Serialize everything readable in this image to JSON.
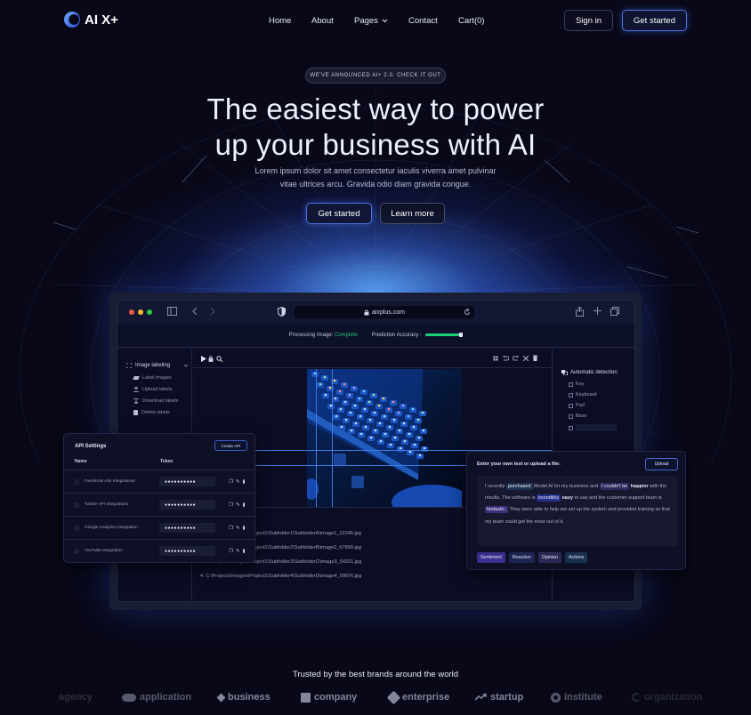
{
  "nav": {
    "logo_text": "AI X+",
    "links": [
      {
        "label": "Home"
      },
      {
        "label": "About"
      },
      {
        "label": "Pages",
        "has_dropdown": true
      },
      {
        "label": "Contact"
      },
      {
        "label": "Cart(0)"
      }
    ],
    "signin_label": "Sign in",
    "getstarted_label": "Get started"
  },
  "hero": {
    "announcement": "WE'VE ANNOUNCED AI+ 2.0. CHECK IT OUT",
    "headline_line1": "The easiest way to power",
    "headline_line2": "up your business with AI",
    "subtext_line1": "Lorem ipsum dolor sit amet consectetur iaculis viverra amet pulvinar",
    "subtext_line2": "vitae ultrices arcu. Gravida odio diam gravida congue.",
    "primary_cta": "Get started",
    "secondary_cta": "Learn more"
  },
  "browser": {
    "url": "aixplus.com",
    "status_label": "Processing Image:",
    "status_value": "Complete",
    "accuracy_label": "Prediction Accuracy :",
    "accuracy_fraction": 0.95,
    "colors": {
      "status_ok": "#26c07a",
      "progress": "#1fd07a"
    },
    "sidebar": {
      "section": "Image labeling",
      "items": [
        {
          "icon": "tag-icon",
          "label": "Label images"
        },
        {
          "icon": "upload-icon",
          "label": "Upload labels"
        },
        {
          "icon": "download-icon",
          "label": "Download labels"
        },
        {
          "icon": "trash-icon",
          "label": "Delete labels"
        }
      ]
    },
    "detection": {
      "title": "Automatic detection",
      "items": [
        "Key",
        "Keyboard",
        "Pad",
        "Base",
        ""
      ]
    },
    "files": [
      "1. C:\\Projects\\Images\\Project1\\Subfolder1\\SubfolderA\\image1_12345.jpg",
      "2. C:\\Projects\\Images\\Project1\\Subfolder2\\SubfolderB\\image2_67890.jpg",
      "3. C:\\Projects\\Images\\Project1\\Subfolder3\\SubfolderC\\image3_54321.jpg",
      "4. C:\\Projects\\Images\\Project1\\Subfolder4\\SubfolderD\\image4_09876.jpg"
    ]
  },
  "api": {
    "title": "API Settings",
    "create_label": "Create API",
    "col_name": "Name",
    "col_token": "Token",
    "rows": [
      {
        "name": "Facebook Ads Integrations",
        "token": "●●●●●●●●●●"
      },
      {
        "name": "Twitter API Integrations",
        "token": "●●●●●●●●●●"
      },
      {
        "name": "Google Analytics Integration",
        "token": "●●●●●●●●●●"
      },
      {
        "name": "YouTube Integration",
        "token": "●●●●●●●●●●"
      }
    ]
  },
  "textcard": {
    "title": "Enter your own text or upload a file:",
    "upload_label": "Upload",
    "segments": {
      "s1": "I recently ",
      "h1": "purchased",
      "s2": " Model AI for my business and ",
      "h2": "I couldn't be",
      "b1": "happier",
      "s3": " with the results. The software is ",
      "h3": "incredibly",
      "b2": "easy",
      "s4": " to use and the customer support team is ",
      "h4": "fantastic.",
      "s5": " They were able to help me set up the system and provided training so that my team could get the most out of it."
    },
    "tags": [
      {
        "label": "Sentiment",
        "color": "#3a2f8c"
      },
      {
        "label": "Reaction",
        "color": "#1e2450"
      },
      {
        "label": "Opinion",
        "color": "#2c2a55"
      },
      {
        "label": "Actions",
        "color": "#1b2f4f"
      }
    ]
  },
  "brands": {
    "heading": "Trusted by the best brands around the world",
    "items": [
      {
        "name": "agency"
      },
      {
        "name": "application"
      },
      {
        "name": "business"
      },
      {
        "name": "company"
      },
      {
        "name": "enterprise"
      },
      {
        "name": "startup"
      },
      {
        "name": "institute"
      },
      {
        "name": "organization"
      }
    ]
  }
}
